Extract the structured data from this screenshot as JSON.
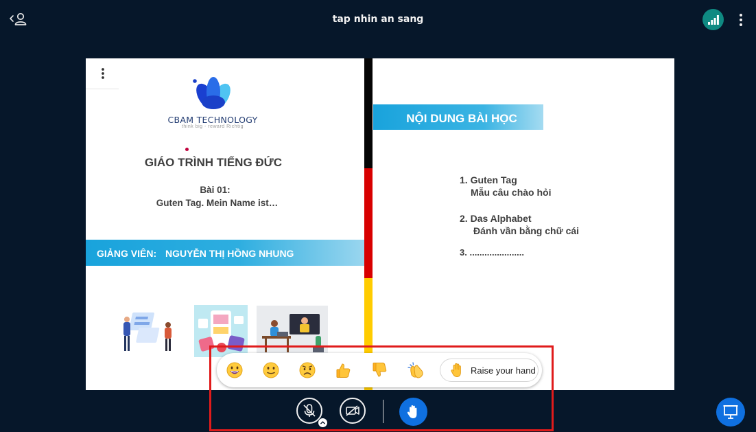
{
  "header": {
    "meeting_title": "tap nhin an sang",
    "user_list_icon": "user-icon",
    "connection_icon": "connection-status-icon",
    "options_icon": "kebab-menu-icon"
  },
  "slide": {
    "options_icon": "kebab-menu-icon",
    "logo": {
      "name": "CBAM TECHNOLOGY",
      "tagline": "think big - reward Richtig"
    },
    "course_title": "GIÁO TRÌNH TIẾNG ĐỨC",
    "lesson_number": "Bài 01:",
    "lesson_title": "Guten Tag. Mein Name ist…",
    "teacher_label": "GIẢNG VIÊN:",
    "teacher_name": "NGUYỄN THỊ HỒNG NHUNG",
    "content_title": "NỘI DUNG BÀI HỌC",
    "content_items": [
      {
        "number": "1.",
        "title": "Guten Tag",
        "subtitle": "Mẫu câu chào hỏi"
      },
      {
        "number": "2.",
        "title": "Das Alphabet",
        "subtitle": "Đánh vần bằng chữ cái"
      },
      {
        "number": "3.",
        "title": "......................"
      }
    ],
    "flag_colors": [
      "#050505",
      "#d80000",
      "#ffcc00"
    ]
  },
  "reactions": {
    "items": [
      "smiley-face-icon",
      "neutral-face-icon",
      "sad-face-icon",
      "thumbs-up-icon",
      "thumbs-down-icon",
      "clapping-hands-icon"
    ],
    "raise_hand_label": "Raise your hand",
    "raise_hand_icon": "raised-hand-icon"
  },
  "controls": {
    "mic_icon": "microphone-muted-icon",
    "camera_icon": "camera-off-icon",
    "hand_icon": "raised-hand-icon",
    "presentation_icon": "presentation-icon",
    "accent": "#0f70e0"
  },
  "colors": {
    "background": "#06172a",
    "highlight_border": "#e01b1b",
    "banner_blue": "#19a3dc"
  }
}
